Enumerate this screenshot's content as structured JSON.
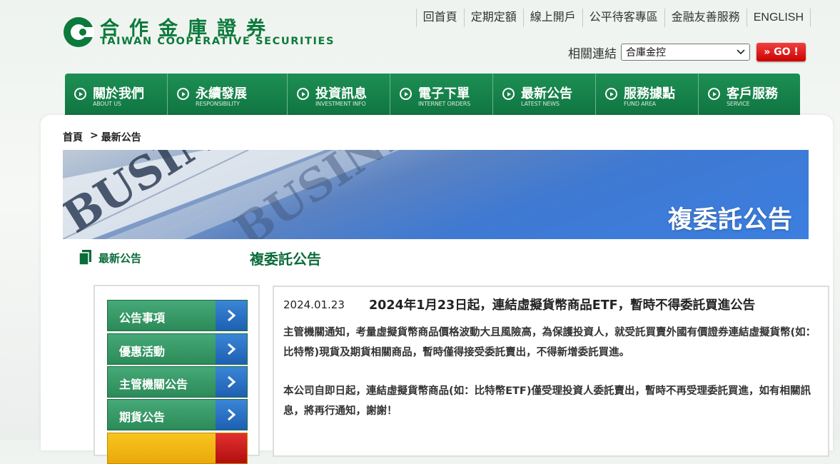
{
  "brand": {
    "name_cn": "合作金庫證券",
    "name_en": "TAIWAN COOPERATIVE SECURITIES",
    "color": "#0b7a3b"
  },
  "top_links": [
    "回首頁",
    "定期定額",
    "線上開戶",
    "公平待客專區",
    "金融友善服務",
    "ENGLISH"
  ],
  "related": {
    "label": "相關連結",
    "selected": "合庫金控",
    "go_label": "» GO !"
  },
  "main_nav": [
    {
      "zh": "關於我們",
      "en": "ABOUT US"
    },
    {
      "zh": "永續發展",
      "en": "RESPONSIBILITY"
    },
    {
      "zh": "投資訊息",
      "en": "INVESTMENT INFO"
    },
    {
      "zh": "電子下單",
      "en": "INTERNET ORDERS"
    },
    {
      "zh": "最新公告",
      "en": "LATEST NEWS"
    },
    {
      "zh": "服務據點",
      "en": "FUND AREA"
    },
    {
      "zh": "客戶服務",
      "en": "SERVICE"
    }
  ],
  "breadcrumb": {
    "home": "首頁",
    "sep": ">",
    "current": "最新公告"
  },
  "banner": {
    "title": "複委託公告",
    "bg_text": "BUSINESS"
  },
  "sidebar": {
    "title": "最新公告",
    "items": [
      "公告事項",
      "優惠活動",
      "主管機關公告",
      "期貨公告"
    ]
  },
  "page_title": "複委託公告",
  "article": {
    "date": "2024.01.23",
    "headline": "2024年1月23日起，連結虛擬貨幣商品ETF，暫時不得委託買進公告",
    "para1": "主管機關通知，考量虛擬貨幣商品價格波動大且風險高，為保護投資人，就受託買賣外國有價證券連結虛擬貨幣(如：比特幣)現貨及期貨相關商品，暫時僅得接受委託賣出，不得新增委託買進。",
    "para2": "本公司自即日起，連結虛擬貨幣商品(如：比特幣ETF)僅受理投資人委託賣出，暫時不再受理委託買進，如有相關訊息，將再行通知，謝謝！"
  }
}
